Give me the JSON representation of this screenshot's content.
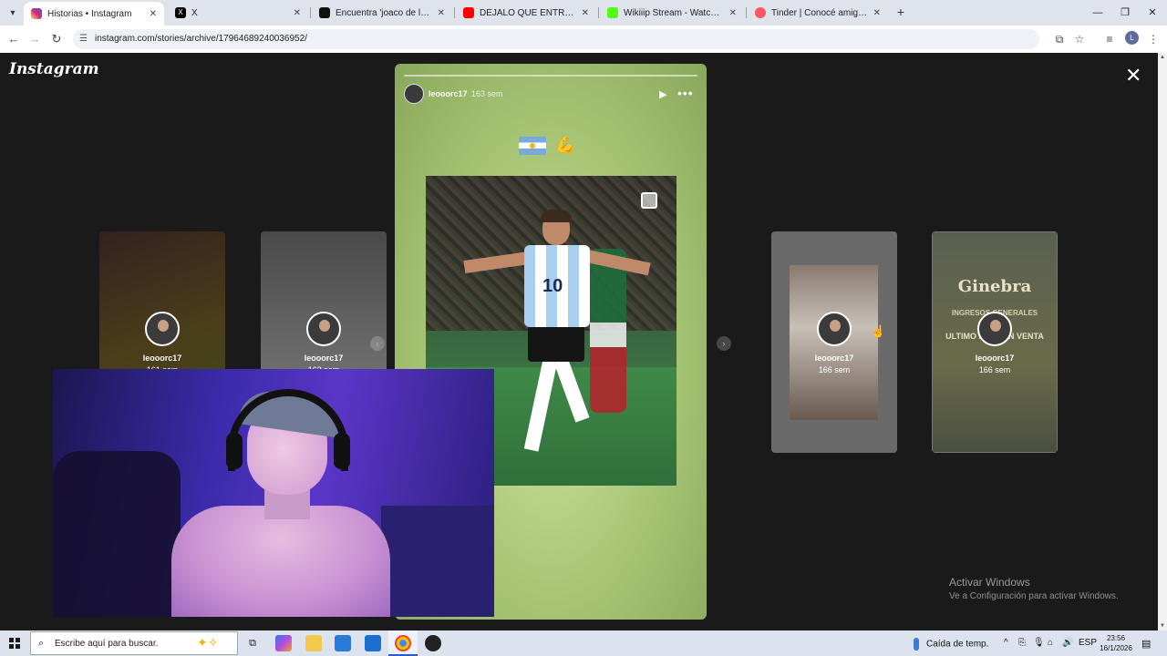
{
  "browser": {
    "tabs": [
      {
        "title": "Historias • Instagram",
        "favicon_color": "#d6249f",
        "active": true
      },
      {
        "title": "X",
        "favicon_color": "#000000",
        "active": false
      },
      {
        "title": "Encuentra 'joaco de la rosa tem",
        "favicon_color": "#111111",
        "active": false
      },
      {
        "title": "DÉJALO QUE ENTRE - Elian G (A",
        "favicon_color": "#ff0000",
        "active": false
      },
      {
        "title": "Wikiiip Stream - Watch Live on",
        "favicon_color": "#53fc18",
        "active": false
      },
      {
        "title": "Tinder | Conocé amigos y gente",
        "favicon_color": "#fd5564",
        "active": false
      }
    ],
    "url": "instagram.com/stories/archive/17964689240036952/",
    "profile_initial": "L"
  },
  "instagram": {
    "logo": "Instagram",
    "story": {
      "username": "leooorc17",
      "time": "163 sem"
    },
    "left_cards": [
      {
        "username": "leooorc17",
        "time": "161 sem"
      },
      {
        "username": "leooorc17",
        "time": "163 sem"
      }
    ],
    "right_cards": [
      {
        "username": "leooorc17",
        "time": "166 sem"
      },
      {
        "username": "leooorc17",
        "time": "166 sem",
        "poster_title": "Ginebra",
        "poster_line1": "INGRESOS GENERALES",
        "poster_line2": "ULTIMO LOTE EN VENTA"
      }
    ]
  },
  "watermark": {
    "line1": "Activar Windows",
    "line2": "Ve a Configuración para activar Windows."
  },
  "taskbar": {
    "search_placeholder": "Escribe aquí para buscar.",
    "weather": "Caída de temp.",
    "language": "ESP",
    "time": "23:56",
    "date": "16/1/2026"
  }
}
